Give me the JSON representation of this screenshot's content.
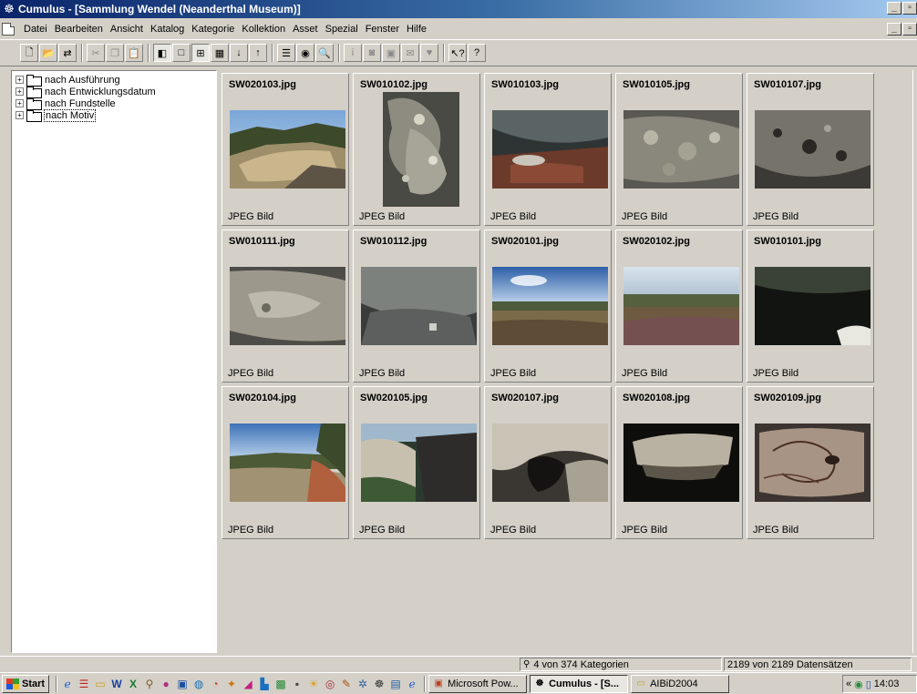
{
  "window": {
    "title": "Cumulus - [Sammlung Wendel (Neanderthal Museum)]"
  },
  "menu": {
    "items": [
      "Datei",
      "Bearbeiten",
      "Ansicht",
      "Katalog",
      "Kategorie",
      "Kollektion",
      "Asset",
      "Spezial",
      "Fenster",
      "Hilfe"
    ]
  },
  "toolbar": {
    "icons": [
      "new-icon",
      "open-icon",
      "sync-icon",
      "cut-icon",
      "copy-icon",
      "paste-icon",
      "tree-view-icon",
      "single-view-icon",
      "thumbnail-view-icon",
      "detail-view-icon",
      "sort-asc-icon",
      "sort-desc-icon",
      "record-list-icon",
      "preview-icon",
      "find-icon",
      "info-icon",
      "camera-icon",
      "print-icon",
      "mail-icon",
      "shield-icon",
      "context-help-icon",
      "help-icon"
    ]
  },
  "tree": {
    "items": [
      {
        "label": "nach Ausführung",
        "expander": "+"
      },
      {
        "label": "nach Entwicklungsdatum",
        "expander": "+"
      },
      {
        "label": "nach Fundstelle",
        "expander": "+"
      },
      {
        "label": "nach Motiv",
        "expander": "+",
        "selected": true
      }
    ]
  },
  "assets": [
    {
      "name": "SW020103.jpg",
      "type": "JPEG Bild"
    },
    {
      "name": "SW010102.jpg",
      "type": "JPEG Bild"
    },
    {
      "name": "SW010103.jpg",
      "type": "JPEG Bild"
    },
    {
      "name": "SW010105.jpg",
      "type": "JPEG Bild"
    },
    {
      "name": "SW010107.jpg",
      "type": "JPEG Bild"
    },
    {
      "name": "SW010111.jpg",
      "type": "JPEG Bild"
    },
    {
      "name": "SW010112.jpg",
      "type": "JPEG Bild"
    },
    {
      "name": "SW020101.jpg",
      "type": "JPEG Bild"
    },
    {
      "name": "SW020102.jpg",
      "type": "JPEG Bild"
    },
    {
      "name": "SW010101.jpg",
      "type": "JPEG Bild"
    },
    {
      "name": "SW020104.jpg",
      "type": "JPEG Bild"
    },
    {
      "name": "SW020105.jpg",
      "type": "JPEG Bild"
    },
    {
      "name": "SW020107.jpg",
      "type": "JPEG Bild"
    },
    {
      "name": "SW020108.jpg",
      "type": "JPEG Bild"
    },
    {
      "name": "SW020109.jpg",
      "type": "JPEG Bild"
    }
  ],
  "status": {
    "categories": "4 von 374 Kategorien",
    "records": "2189 von 2189 Datensätzen"
  },
  "taskbar": {
    "start_label": "Start",
    "tasks": [
      {
        "label": "Microsoft Pow...",
        "active": false
      },
      {
        "label": "Cumulus - [S...",
        "active": true
      },
      {
        "label": "AIBiD2004",
        "active": false
      }
    ],
    "clock": "14:03",
    "tray_prefix": "«"
  }
}
